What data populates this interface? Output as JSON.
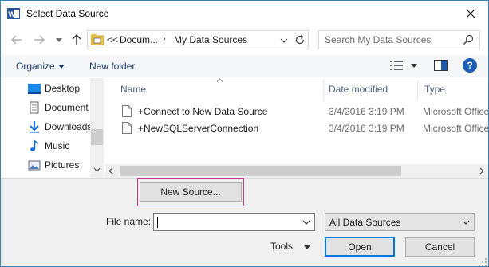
{
  "window": {
    "title": "Select Data Source"
  },
  "address": {
    "prefix": "<<",
    "parent": "Docum...",
    "separator": "›",
    "current": "My Data Sources"
  },
  "search": {
    "placeholder": "Search My Data Sources"
  },
  "toolbar": {
    "organize": "Organize",
    "new_folder": "New folder",
    "help": "?"
  },
  "sidebar": {
    "items": [
      {
        "label": "Desktop",
        "icon": "desktop-icon"
      },
      {
        "label": "Document",
        "icon": "documents-icon"
      },
      {
        "label": "Downloads",
        "icon": "downloads-icon"
      },
      {
        "label": "Music",
        "icon": "music-icon"
      },
      {
        "label": "Pictures",
        "icon": "pictures-icon"
      }
    ]
  },
  "list": {
    "columns": {
      "name": "Name",
      "date": "Date modified",
      "type": "Type"
    },
    "rows": [
      {
        "name": "+Connect to New Data Source",
        "date": "3/4/2016 3:19 PM",
        "type": "Microsoft Office"
      },
      {
        "name": "+NewSQLServerConnection",
        "date": "3/4/2016 3:19 PM",
        "type": "Microsoft Office"
      }
    ]
  },
  "footer": {
    "new_source": "New Source...",
    "file_name_label": "File name:",
    "file_name_value": "",
    "filter": "All Data Sources",
    "tools": "Tools",
    "open": "Open",
    "cancel": "Cancel"
  },
  "colors": {
    "accent": "#0078d7",
    "highlight_box": "#c8358a",
    "help_blue": "#1c5fb2"
  }
}
